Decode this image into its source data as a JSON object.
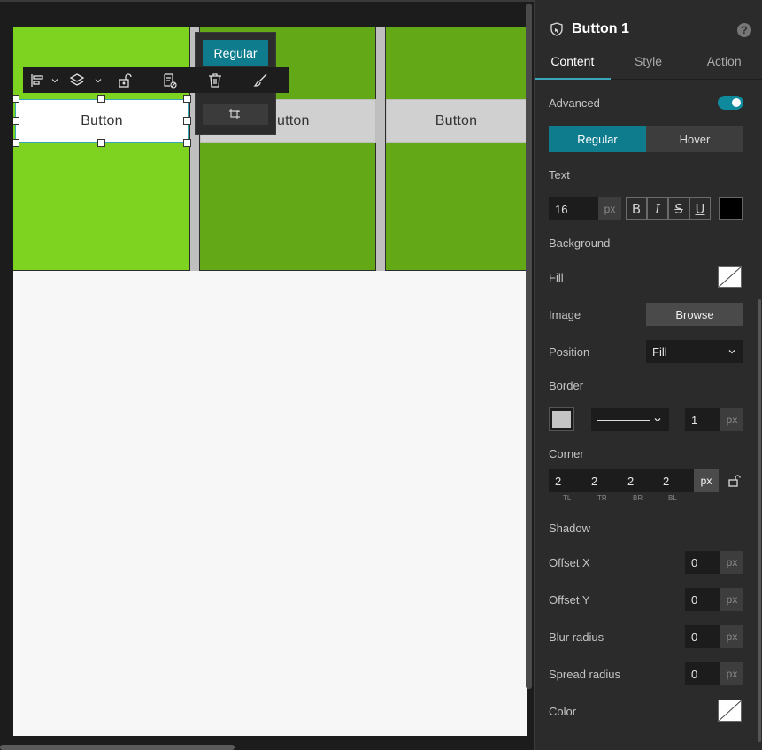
{
  "canvas": {
    "buttons": [
      "Button",
      "utton",
      "Button"
    ],
    "state_popover": {
      "active_label": "Regular"
    }
  },
  "toolbar": {
    "items": [
      "align-left-icon",
      "chevron-down-icon",
      "layers-icon",
      "chevron-down-icon",
      "unlock-icon",
      "page-settings-icon",
      "trash-icon",
      "brush-icon"
    ]
  },
  "panel": {
    "title": "Button 1",
    "help": "?",
    "tabs": [
      "Content",
      "Style",
      "Action"
    ],
    "active_tab": "Style",
    "advanced_label": "Advanced",
    "advanced_on": true,
    "states": [
      "Regular",
      "Hover"
    ],
    "text": {
      "label": "Text",
      "size": "16",
      "unit": "px",
      "format_buttons": [
        "B",
        "I",
        "S",
        "U"
      ],
      "color": "#000000"
    },
    "background": {
      "label": "Background",
      "fill_label": "Fill",
      "image_label": "Image",
      "browse_label": "Browse",
      "position_label": "Position",
      "position_value": "Fill"
    },
    "border": {
      "label": "Border",
      "color": "#c4c4c4",
      "width": "1",
      "unit": "px"
    },
    "corner": {
      "label": "Corner",
      "values": [
        "2",
        "2",
        "2",
        "2"
      ],
      "sublabels": [
        "TL",
        "TR",
        "BR",
        "BL"
      ],
      "unit": "px"
    },
    "shadow": {
      "label": "Shadow",
      "offset_x_label": "Offset X",
      "offset_x": "0",
      "offset_y_label": "Offset Y",
      "offset_y": "0",
      "blur_label": "Blur radius",
      "blur": "0",
      "spread_label": "Spread radius",
      "spread": "0",
      "color_label": "Color",
      "unit": "px"
    }
  },
  "colors": {
    "accent": "#0e7c8d",
    "column_selected": "#7ed321",
    "column": "#63a817"
  }
}
